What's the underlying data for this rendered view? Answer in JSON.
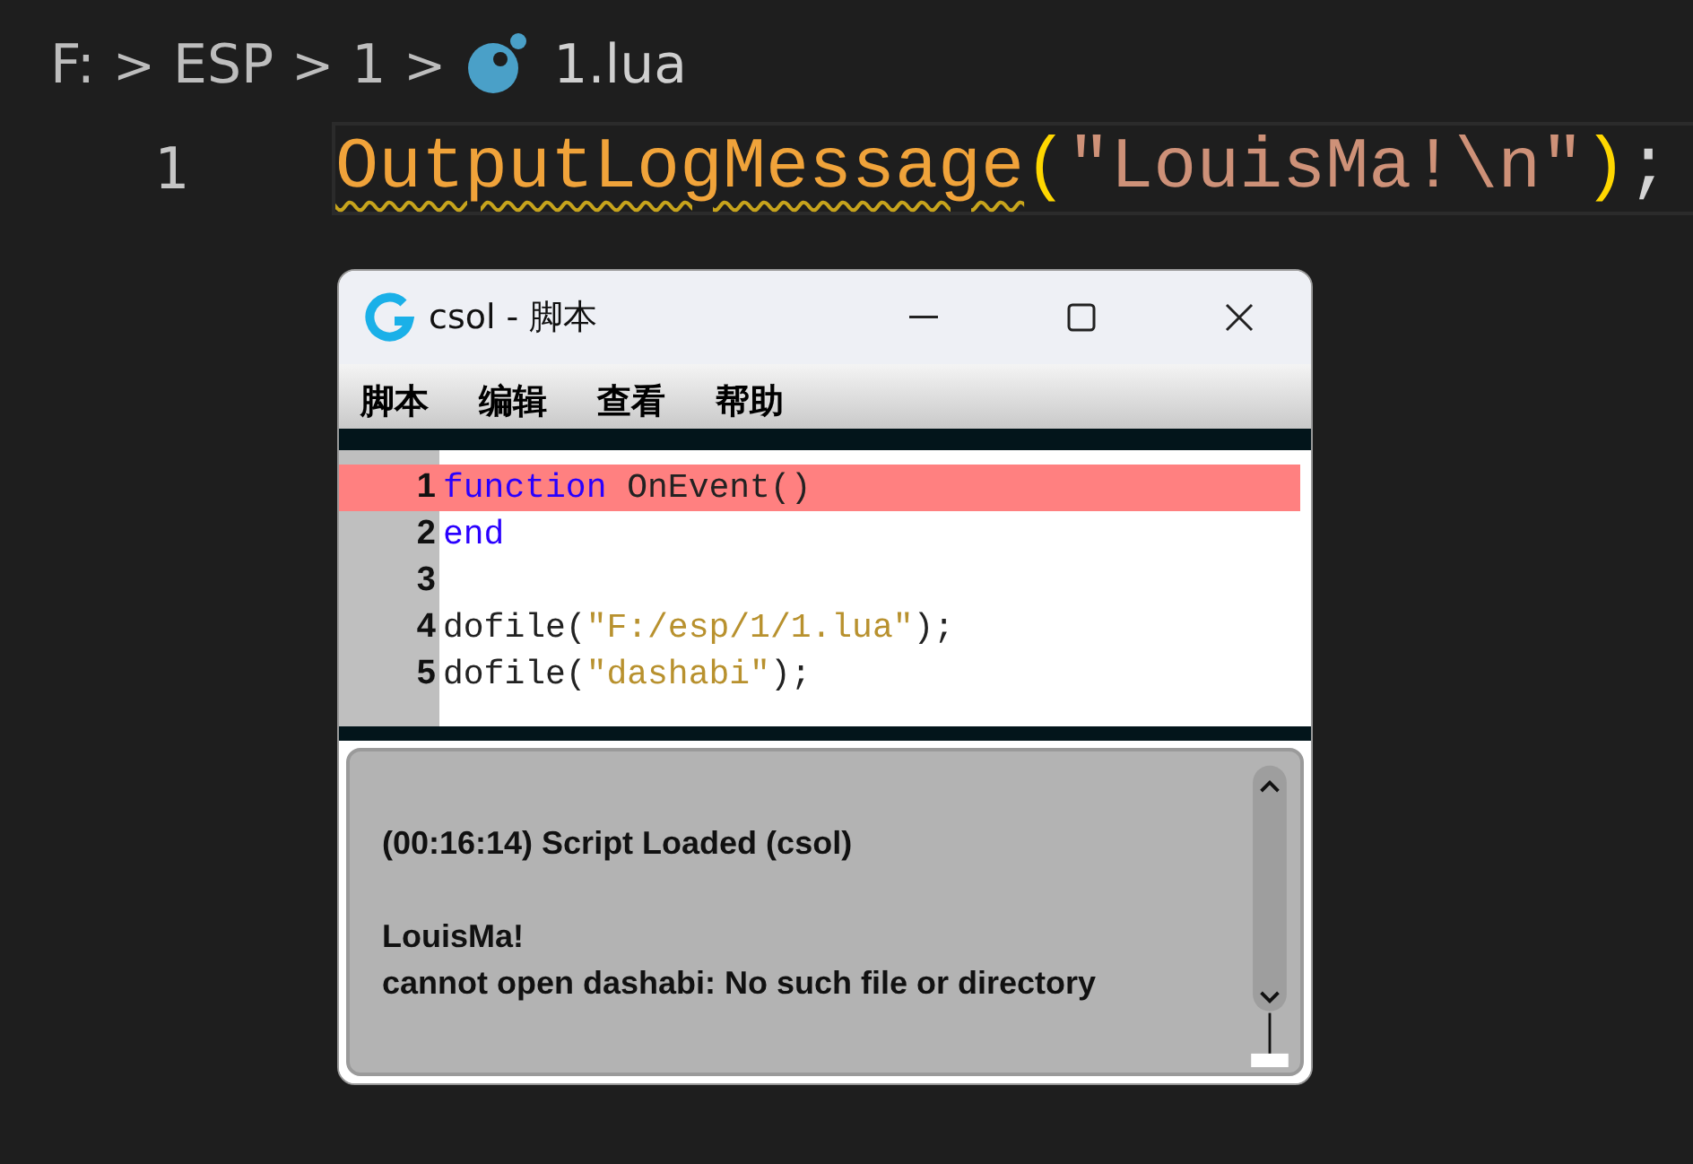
{
  "breadcrumb": {
    "items": [
      "F:",
      "ESP",
      "1"
    ],
    "separator": ">",
    "file": "1.lua"
  },
  "editor": {
    "lines": [
      {
        "number": "1",
        "current": true,
        "tokens": [
          {
            "kind": "function",
            "text": "OutputLogMessage",
            "warning": true
          },
          {
            "kind": "paren",
            "text": "(",
            "warning": false
          },
          {
            "kind": "string",
            "text": "\"LouisMa!\\n\"",
            "warning": false
          },
          {
            "kind": "paren",
            "text": ")",
            "warning": false
          },
          {
            "kind": "plain",
            "text": ";",
            "warning": false
          }
        ]
      }
    ]
  },
  "window": {
    "title": "csol - 脚本",
    "menu": [
      "脚本",
      "编辑",
      "查看",
      "帮助"
    ],
    "script": {
      "lines": [
        {
          "number": "1",
          "highlighted": true,
          "tokens": [
            {
              "kind": "keyword",
              "text": "function"
            },
            {
              "kind": "plain",
              "text": " OnEvent()"
            }
          ]
        },
        {
          "number": "2",
          "highlighted": false,
          "tokens": [
            {
              "kind": "keyword",
              "text": "end"
            }
          ]
        },
        {
          "number": "3",
          "highlighted": false
        },
        {
          "number": "4",
          "highlighted": false,
          "tokens": [
            {
              "kind": "plain",
              "text": "dofile("
            },
            {
              "kind": "string",
              "text": "\"F:/esp/1/1.lua\""
            },
            {
              "kind": "plain",
              "text": ");"
            }
          ]
        },
        {
          "number": "5",
          "highlighted": false,
          "tokens": [
            {
              "kind": "plain",
              "text": "dofile("
            },
            {
              "kind": "string",
              "text": "\"dashabi\""
            },
            {
              "kind": "plain",
              "text": ");"
            }
          ]
        }
      ]
    },
    "log": {
      "entries": [
        {
          "lines": [
            "(00:16:14) Script Loaded (csol)"
          ]
        },
        {
          "lines": [
            "LouisMa!",
            "cannot open dashabi: No such file or directory"
          ]
        }
      ]
    }
  }
}
